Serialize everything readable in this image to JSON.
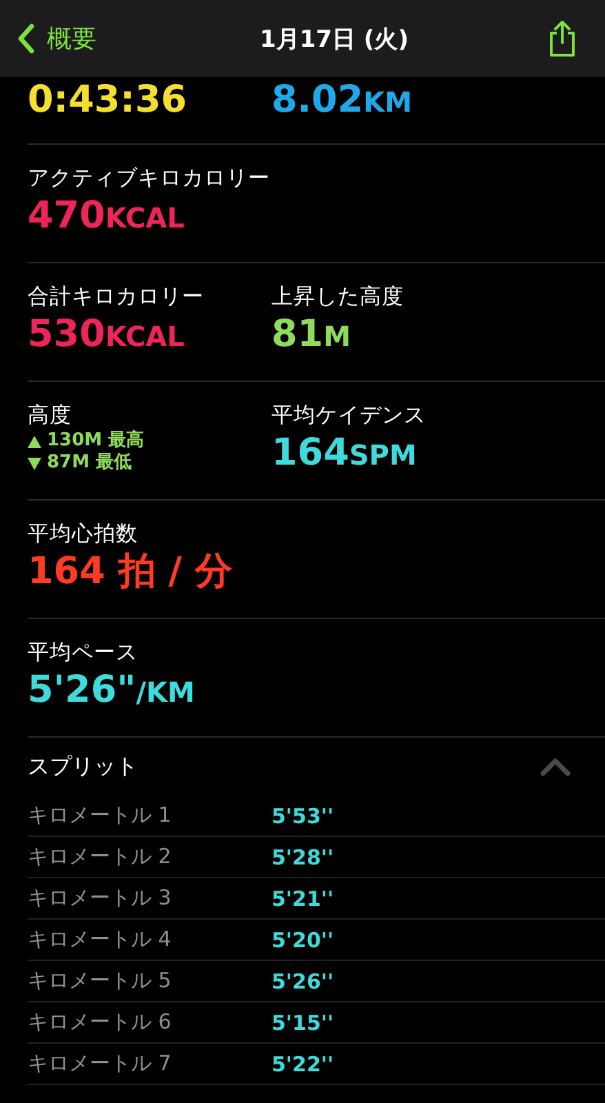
{
  "nav": {
    "back": "概要",
    "title": "1月17日 (火)"
  },
  "rows": [
    {
      "cells": [
        {
          "kind": "value",
          "value": "0:43:36",
          "color": "#f5df2e"
        },
        {
          "kind": "value",
          "value": "8.02",
          "unit": "KM",
          "color": "#1eaaea"
        }
      ]
    },
    {
      "cells": [
        {
          "kind": "value",
          "label": "アクティブキロカロリー",
          "value": "470",
          "unit": "KCAL",
          "color": "#f1245a"
        }
      ]
    },
    {
      "cells": [
        {
          "kind": "value",
          "label": "合計キロカロリー",
          "value": "530",
          "unit": "KCAL",
          "color": "#f1245a"
        },
        {
          "kind": "value",
          "label": "上昇した高度",
          "value": "81",
          "unit": "M",
          "color": "#8fdb5b"
        }
      ]
    },
    {
      "cells": [
        {
          "kind": "range",
          "label": "高度",
          "high": "130M 最高",
          "low": "87M 最低",
          "color": "#8fdb5b"
        },
        {
          "kind": "value",
          "label": "平均ケイデンス",
          "value": "164",
          "unit": "SPM",
          "color": "#3ddbdb"
        }
      ]
    },
    {
      "cells": [
        {
          "kind": "value",
          "label": "平均心拍数",
          "value": "164 拍 / 分",
          "color": "#ff3b22"
        }
      ]
    },
    {
      "cells": [
        {
          "kind": "value",
          "label": "平均ペース",
          "value": "5'26\"",
          "unit": "/KM",
          "color": "#3ddbdb"
        }
      ]
    }
  ],
  "splits": {
    "title": "スプリット",
    "expanded": true,
    "items": [
      {
        "name": "キロメートル 1",
        "pace": "5'53''"
      },
      {
        "name": "キロメートル 2",
        "pace": "5'28''"
      },
      {
        "name": "キロメートル 3",
        "pace": "5'21''"
      },
      {
        "name": "キロメートル 4",
        "pace": "5'20''"
      },
      {
        "name": "キロメートル 5",
        "pace": "5'26''"
      },
      {
        "name": "キロメートル 6",
        "pace": "5'15''"
      },
      {
        "name": "キロメートル 7",
        "pace": "5'22''"
      }
    ]
  }
}
